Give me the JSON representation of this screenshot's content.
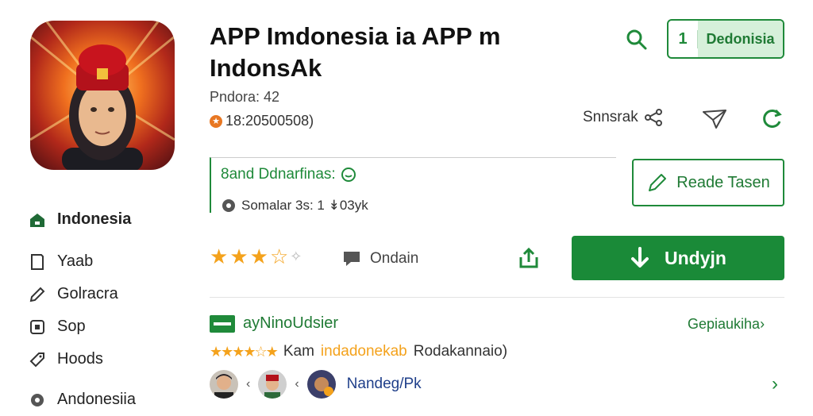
{
  "app": {
    "title_line1": "APP Imdonesia ia APP m",
    "title_line2": "IndonsAk",
    "meta1": "Pndora: 42",
    "meta2": "18:20500508)"
  },
  "header": {
    "tab_number": "1",
    "tab_label": "Dedonisia"
  },
  "actions": {
    "share_label": "Snnsrak",
    "review_button": "Reade Tasen",
    "install_button": "Undyjn"
  },
  "info": {
    "title": "8and Ddnarfinas:",
    "subtitle": "Somalar 3s: 1 ↡03yk"
  },
  "rating": {
    "value": 3.5,
    "comment_label": "Ondain"
  },
  "sidebar": {
    "items": [
      {
        "label": "Indonesia",
        "icon": "home-icon"
      },
      {
        "label": "Yaab",
        "icon": "bookmark-icon"
      },
      {
        "label": "Golracra",
        "icon": "pencil-icon"
      },
      {
        "label": "Sop",
        "icon": "square-icon"
      },
      {
        "label": "Hoods",
        "icon": "tag-icon"
      },
      {
        "label": "Andonesiia",
        "icon": "location-icon"
      }
    ]
  },
  "developer": {
    "name": "ayNinoUdsier",
    "more_link": "Gepiaukiha",
    "review_prefix": "Kam",
    "review_highlight": "indadonekab",
    "review_suffix": "Rodakannaio)",
    "avatar_name": "Nandeg/Pk"
  },
  "colors": {
    "accent": "#1f8a3a",
    "star": "#f4a21c"
  }
}
